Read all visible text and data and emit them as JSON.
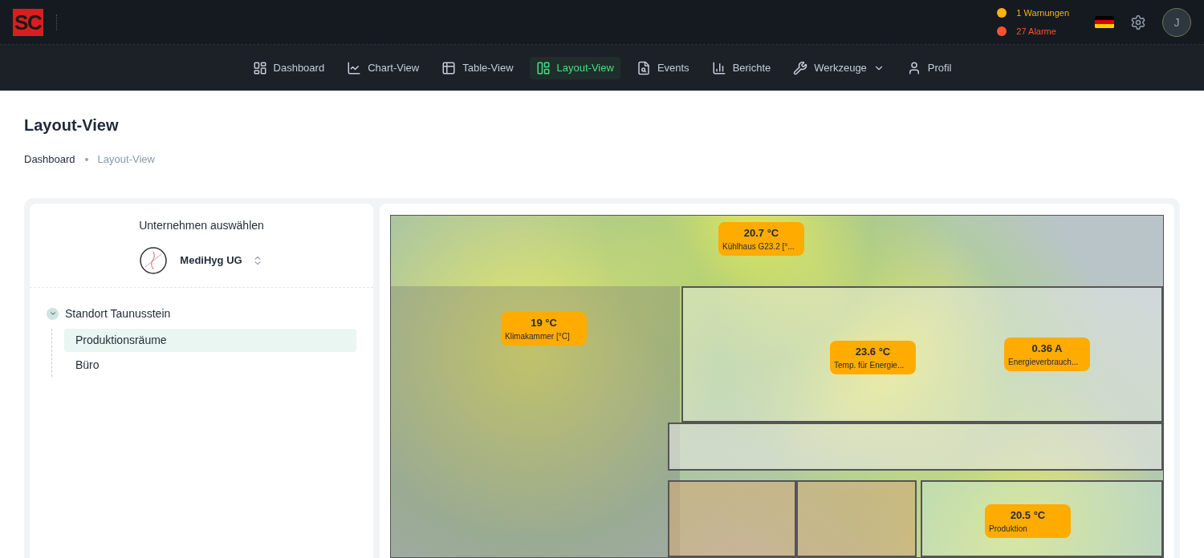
{
  "logo": {
    "text": "SC"
  },
  "alerts": [
    {
      "text": "1 Warnungen",
      "color": "#fbb015"
    },
    {
      "text": "27 Alarme",
      "color": "#f8532f"
    }
  ],
  "avatar": {
    "initial": "J"
  },
  "nav": [
    {
      "label": "Dashboard",
      "selected": false,
      "has_menu": false
    },
    {
      "label": "Chart-View",
      "selected": false,
      "has_menu": false
    },
    {
      "label": "Table-View",
      "selected": false,
      "has_menu": false
    },
    {
      "label": "Layout-View",
      "selected": true,
      "has_menu": false
    },
    {
      "label": "Events",
      "selected": false,
      "has_menu": false
    },
    {
      "label": "Berichte",
      "selected": false,
      "has_menu": false
    },
    {
      "label": "Werkzeuge",
      "selected": false,
      "has_menu": true
    },
    {
      "label": "Profil",
      "selected": false,
      "has_menu": false
    }
  ],
  "page": {
    "title": "Layout-View",
    "breadcrumb": [
      "Dashboard",
      "Layout-View"
    ]
  },
  "company_panel": {
    "heading": "Unternehmen auswählen",
    "company": "MediHyg UG"
  },
  "tree": [
    {
      "label": "Standort Taunusstein",
      "expanded": true,
      "children": [
        {
          "label": "Produktionsräume",
          "selected": true
        },
        {
          "label": "Büro",
          "selected": false
        }
      ]
    }
  ],
  "sensors": [
    {
      "value": "20.7 °C",
      "label": "Kühlhaus G23.2 [°..."
    },
    {
      "value": "19 °C",
      "label": "Klimakammer [°C]"
    },
    {
      "value": "23.6 °C",
      "label": "Temp. für Energie..."
    },
    {
      "value": "0.36 A",
      "label": "Energieverbrauch..."
    },
    {
      "value": "20.5 °C",
      "label": "Produktion"
    }
  ]
}
